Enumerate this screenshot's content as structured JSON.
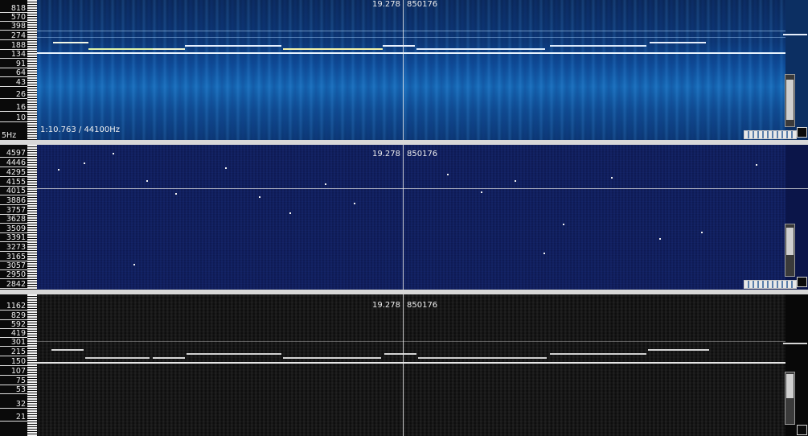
{
  "colors": {
    "pane1_bg": "#0c2f62",
    "pane2_bg": "#0b1549",
    "pane3_bg": "#080808",
    "separator": "#d8d8d8"
  },
  "panes": [
    {
      "cursor_time": "19.278",
      "cursor_value": "850176",
      "freq_labels": [
        "818",
        "570",
        "398",
        "274",
        "188",
        "134",
        "91",
        "64",
        "43",
        "26",
        "16",
        "10"
      ],
      "bottom_label": "5Hz",
      "time_label": "1:10.763 / 44100Hz"
    },
    {
      "cursor_time": "19.278",
      "cursor_value": "850176",
      "freq_labels": [
        "4597",
        "4446",
        "4295",
        "4155",
        "4015",
        "3886",
        "3757",
        "3628",
        "3509",
        "3391",
        "3273",
        "3165",
        "3057",
        "2950",
        "2842"
      ]
    },
    {
      "cursor_time": "19.278",
      "cursor_value": "850176",
      "freq_labels": [
        "1162",
        "829",
        "592",
        "419",
        "301",
        "215",
        "150",
        "107",
        "75",
        "53",
        "32",
        "21"
      ]
    }
  ]
}
